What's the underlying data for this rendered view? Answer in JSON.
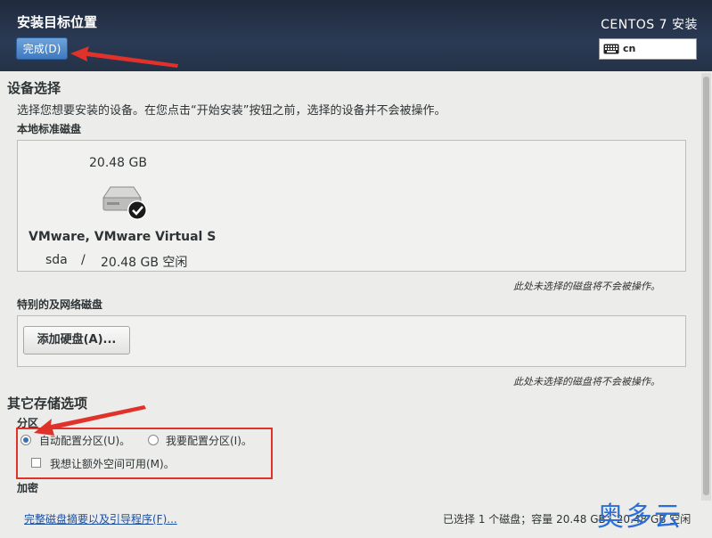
{
  "header": {
    "title": "安装目标位置",
    "done_button": "完成(D)",
    "product": "CENTOS 7 安装",
    "keyboard_layout": "cn"
  },
  "device_selection": {
    "heading": "设备选择",
    "description": "选择您想要安装的设备。在您点击“开始安装”按钮之前，选择的设备并不会被操作。",
    "local_disks_label": "本地标准磁盘",
    "disk": {
      "size": "20.48 GB",
      "name": "VMware, VMware Virtual S",
      "device": "sda",
      "separator": "/",
      "free": "20.48 GB 空闲",
      "selected": true
    },
    "local_note": "此处未选择的磁盘将不会被操作。",
    "special_disks_label": "特别的及网络磁盘",
    "add_disk_button": "添加硬盘(A)...",
    "special_note": "此处未选择的磁盘将不会被操作。"
  },
  "other_storage": {
    "heading": "其它存储选项",
    "partition_label": "分区",
    "auto_partition": "自动配置分区(U)。",
    "manual_partition": "我要配置分区(I)。",
    "extra_space": "我想让额外空间可用(M)。",
    "auto_selected": true,
    "encryption_label": "加密"
  },
  "footer": {
    "summary_link": "完整磁盘摘要以及引导程序(F)...",
    "summary": "已选择 1 个磁盘；容量 20.48 GB；20.48 GB 空闲"
  },
  "watermark": "奥多云",
  "colors": {
    "header_bg": "#2b3a55",
    "accent": "#3e79c0",
    "annotation_red": "#e0322b"
  }
}
